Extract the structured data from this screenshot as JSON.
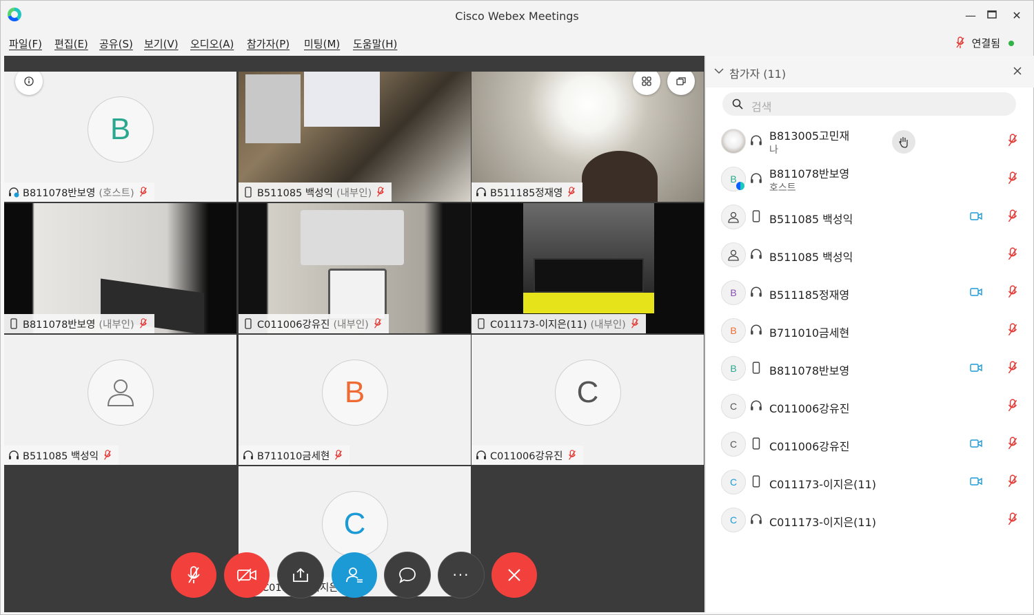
{
  "window": {
    "title": "Cisco Webex Meetings"
  },
  "menu": [
    "파일(F)",
    "편집(E)",
    "공유(S)",
    "보기(V)",
    "오디오(A)",
    "참가자(P)",
    "미팅(M)",
    "도움말(H)"
  ],
  "status": {
    "connection": "연결됨"
  },
  "colors": {
    "red": "#f2403c",
    "blue": "#1b9ad6",
    "green": "#2fb344",
    "teal": "#2aa88f",
    "orange": "#ee6b33",
    "purple": "#8a4fb5"
  },
  "tiles": [
    {
      "name": "B811078반보영",
      "role": "(호스트)",
      "avatar": "B"
    },
    {
      "name": "B511085 백성익",
      "role": "(내부인)",
      "avatar": ""
    },
    {
      "name": "B511185정재영",
      "role": "",
      "avatar": ""
    },
    {
      "name": "B811078반보영",
      "role": "(내부인)",
      "avatar": ""
    },
    {
      "name": "C011006강유진",
      "role": "(내부인)",
      "avatar": ""
    },
    {
      "name": "C011173-이지은(11)",
      "role": "(내부인)",
      "avatar": ""
    },
    {
      "name": "B511085 백성익",
      "role": "",
      "avatar": ""
    },
    {
      "name": "B711010금세현",
      "role": "",
      "avatar": "B"
    },
    {
      "name": "C011006강유진",
      "role": "",
      "avatar": "C"
    },
    {
      "name": "C011173-이지은(11)",
      "role": "",
      "avatar": "C"
    }
  ],
  "panel": {
    "title": "참가자 (11)",
    "search_placeholder": "검색",
    "participants": [
      {
        "name": "B813005고민재",
        "sub": "나",
        "avatar": "",
        "camera": false
      },
      {
        "name": "B811078반보영",
        "sub": "호스트",
        "avatar": "B",
        "camera": false
      },
      {
        "name": "B511085 백성익",
        "sub": "",
        "avatar": "",
        "camera": true
      },
      {
        "name": "B511085 백성익",
        "sub": "",
        "avatar": "",
        "camera": false
      },
      {
        "name": "B511185정재영",
        "sub": "",
        "avatar": "B",
        "camera": true
      },
      {
        "name": "B711010금세현",
        "sub": "",
        "avatar": "B",
        "camera": false
      },
      {
        "name": "B811078반보영",
        "sub": "",
        "avatar": "B",
        "camera": true
      },
      {
        "name": "C011006강유진",
        "sub": "",
        "avatar": "C",
        "camera": false
      },
      {
        "name": "C011006강유진",
        "sub": "",
        "avatar": "C",
        "camera": true
      },
      {
        "name": "C011173-이지은(11)",
        "sub": "",
        "avatar": "C",
        "camera": true
      },
      {
        "name": "C011173-이지은(11)",
        "sub": "",
        "avatar": "C",
        "camera": false
      }
    ]
  }
}
